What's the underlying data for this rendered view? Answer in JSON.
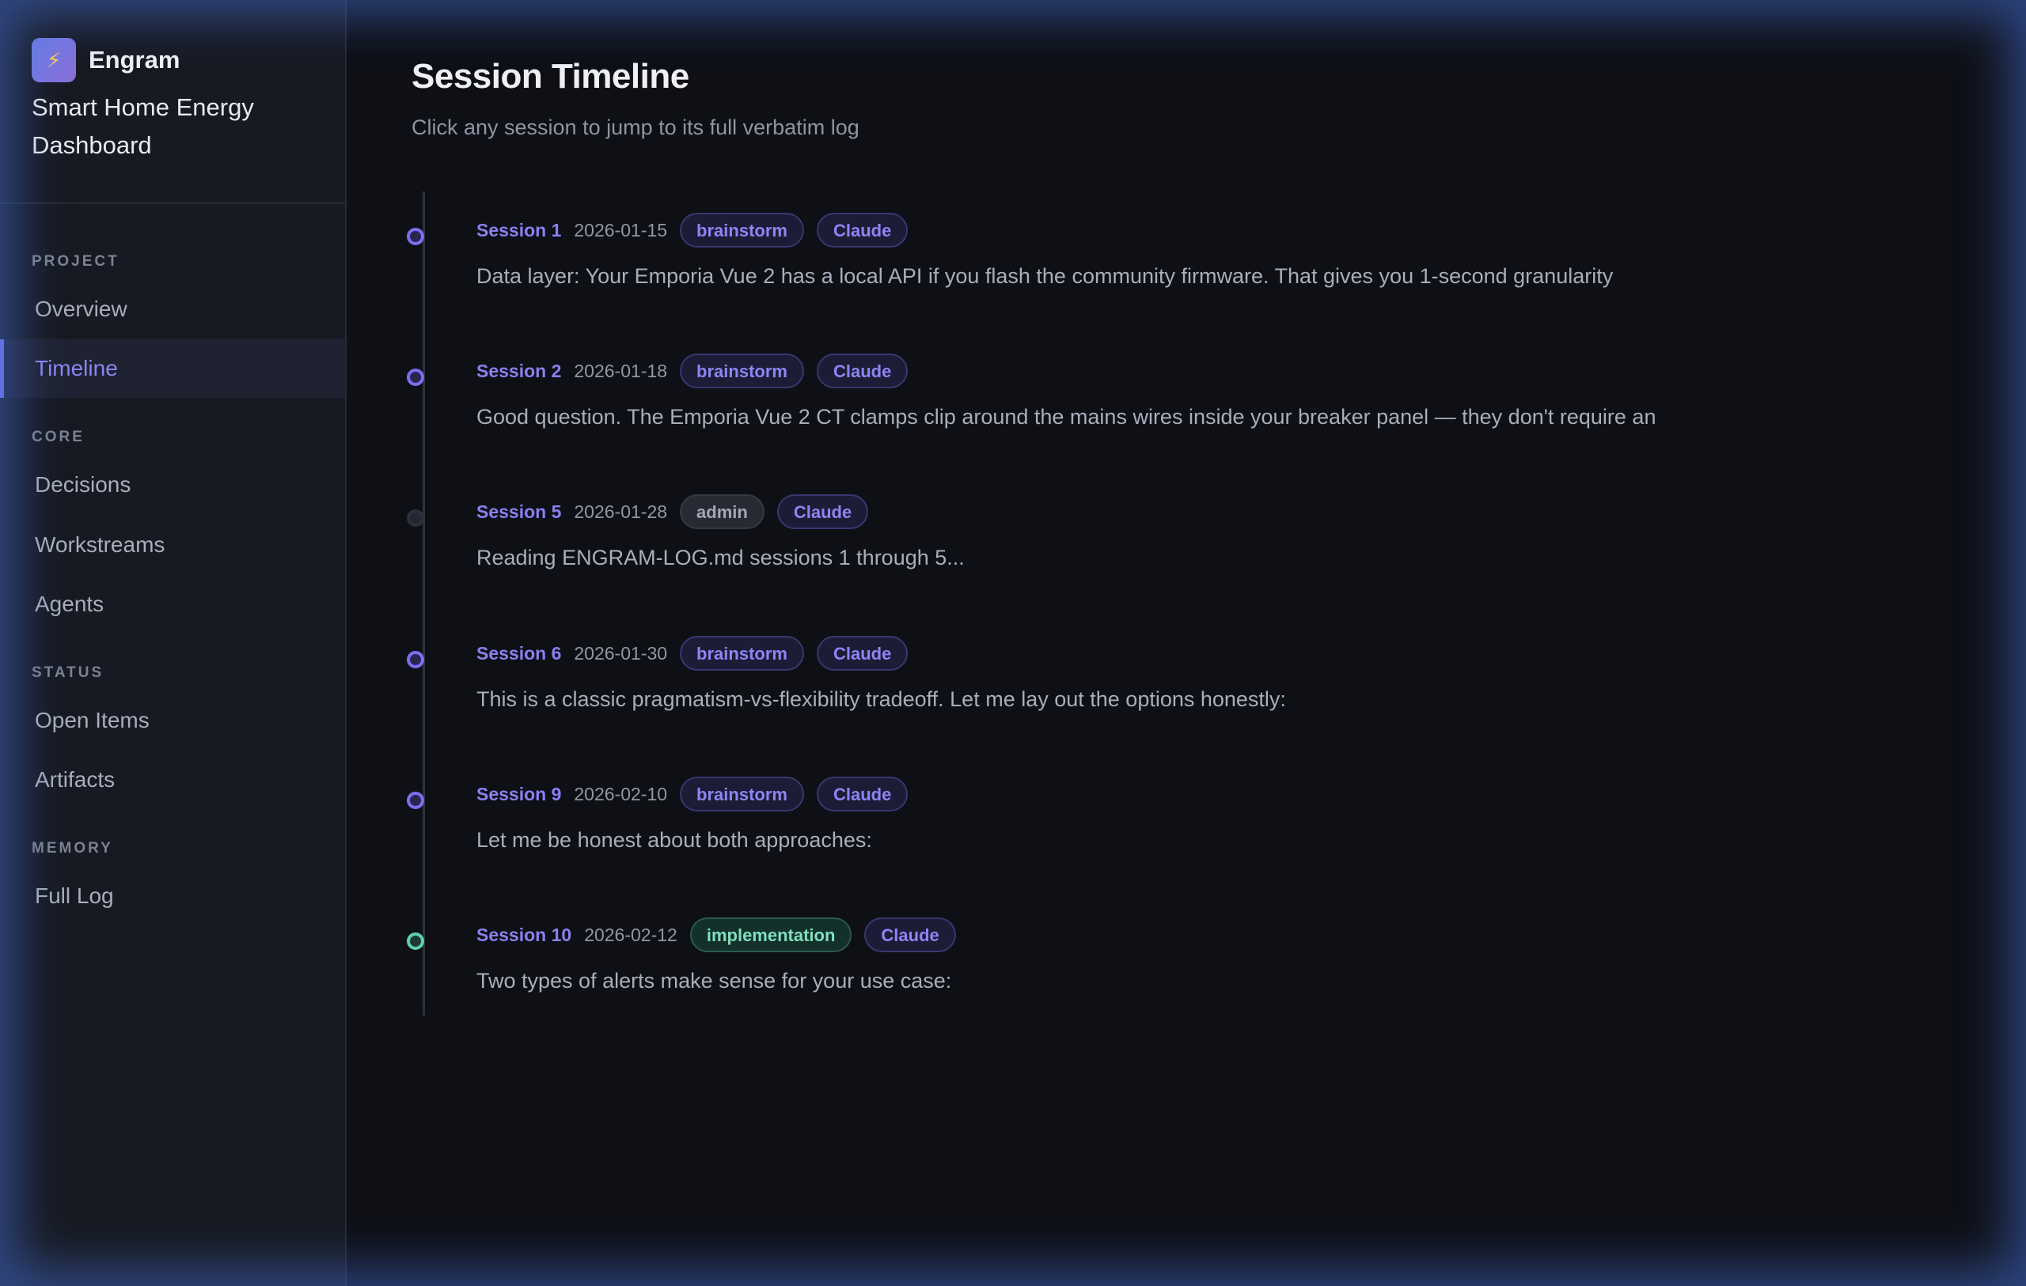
{
  "brand": {
    "name": "Engram",
    "logo_icon": "lightning-icon",
    "logo_glyph": "⚡"
  },
  "project": {
    "name": "Smart Home Energy Dashboard"
  },
  "sidebar": {
    "sections": [
      {
        "title": "PROJECT",
        "items": [
          {
            "label": "Overview"
          },
          {
            "label": "Timeline",
            "active": true
          }
        ]
      },
      {
        "title": "CORE",
        "items": [
          {
            "label": "Decisions"
          },
          {
            "label": "Workstreams"
          },
          {
            "label": "Agents"
          }
        ]
      },
      {
        "title": "STATUS",
        "items": [
          {
            "label": "Open Items"
          },
          {
            "label": "Artifacts"
          }
        ]
      },
      {
        "title": "MEMORY",
        "items": [
          {
            "label": "Full Log"
          }
        ]
      }
    ]
  },
  "main": {
    "title": "Session Timeline",
    "subtitle": "Click any session to jump to its full verbatim log"
  },
  "sessions": [
    {
      "label": "Session 1",
      "date": "2026-01-15",
      "type": "brainstorm",
      "agent": "Claude",
      "snippet": "Data layer: Your Emporia Vue 2 has a local API if you flash the community firmware. That gives you 1-second granularity"
    },
    {
      "label": "Session 2",
      "date": "2026-01-18",
      "type": "brainstorm",
      "agent": "Claude",
      "snippet": "Good question. The Emporia Vue 2 CT clamps clip around the mains wires inside your breaker panel — they don't require an"
    },
    {
      "label": "Session 5",
      "date": "2026-01-28",
      "type": "admin",
      "agent": "Claude",
      "snippet": "Reading ENGRAM-LOG.md sessions 1 through 5..."
    },
    {
      "label": "Session 6",
      "date": "2026-01-30",
      "type": "brainstorm",
      "agent": "Claude",
      "snippet": "This is a classic pragmatism-vs-flexibility tradeoff. Let me lay out the options honestly:"
    },
    {
      "label": "Session 9",
      "date": "2026-02-10",
      "type": "brainstorm",
      "agent": "Claude",
      "snippet": "Let me be honest about both approaches:"
    },
    {
      "label": "Session 10",
      "date": "2026-02-12",
      "type": "implementation",
      "agent": "Claude",
      "snippet": "Two types of alerts make sense for your use case:"
    }
  ],
  "colors": {
    "accent": "#7a6ff0",
    "implementation": "#5fd0a8",
    "admin": "#a3a8b6",
    "background": "#0e1016",
    "sidebar": "#171a22"
  }
}
